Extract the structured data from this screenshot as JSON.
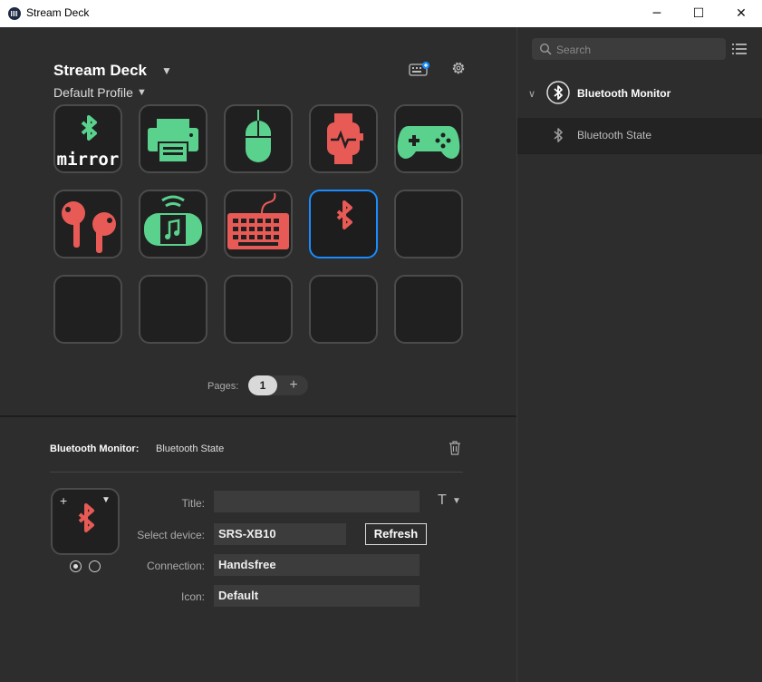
{
  "window": {
    "title": "Stream Deck",
    "minimize_glyph": "─",
    "maximize_glyph": "☐",
    "close_glyph": "✕"
  },
  "deck": {
    "device_name": "Stream Deck",
    "profile": "Default Profile",
    "keys": [
      {
        "icon": "bluetooth-mirror-icon",
        "label": "mirror",
        "color": "#5ad18d"
      },
      {
        "icon": "printer-icon",
        "color": "#5ad18d"
      },
      {
        "icon": "mouse-icon",
        "color": "#5ad18d"
      },
      {
        "icon": "smartwatch-icon",
        "color": "#e85a55"
      },
      {
        "icon": "gamepad-icon",
        "color": "#5ad18d"
      },
      {
        "icon": "earbuds-icon",
        "color": "#e85a55"
      },
      {
        "icon": "speaker-icon",
        "color": "#5ad18d"
      },
      {
        "icon": "keyboard-icon",
        "color": "#e85a55"
      },
      {
        "icon": "bluetooth-icon",
        "color": "#e85a55",
        "selected": true
      },
      {
        "icon": "empty"
      },
      {
        "icon": "empty"
      },
      {
        "icon": "empty"
      },
      {
        "icon": "empty"
      },
      {
        "icon": "empty"
      },
      {
        "icon": "empty"
      }
    ],
    "pages_label": "Pages:",
    "current_page": "1",
    "add_page_glyph": "+"
  },
  "properties": {
    "plugin": "Bluetooth Monitor:",
    "action": "Bluetooth State",
    "title_label": "Title:",
    "title_value": "",
    "device_label": "Select device:",
    "device_value": "SRS-XB10",
    "refresh_label": "Refresh",
    "connection_label": "Connection:",
    "connection_value": "Handsfree",
    "icon_label": "Icon:",
    "icon_value": "Default",
    "text_format_glyph": "T",
    "add_glyph": "+"
  },
  "actions_panel": {
    "search_placeholder": "Search",
    "category": "Bluetooth Monitor",
    "actions": [
      "Bluetooth State"
    ]
  },
  "colors": {
    "accent": "#1a8cff",
    "green": "#5ad18d",
    "red": "#e85a55"
  }
}
